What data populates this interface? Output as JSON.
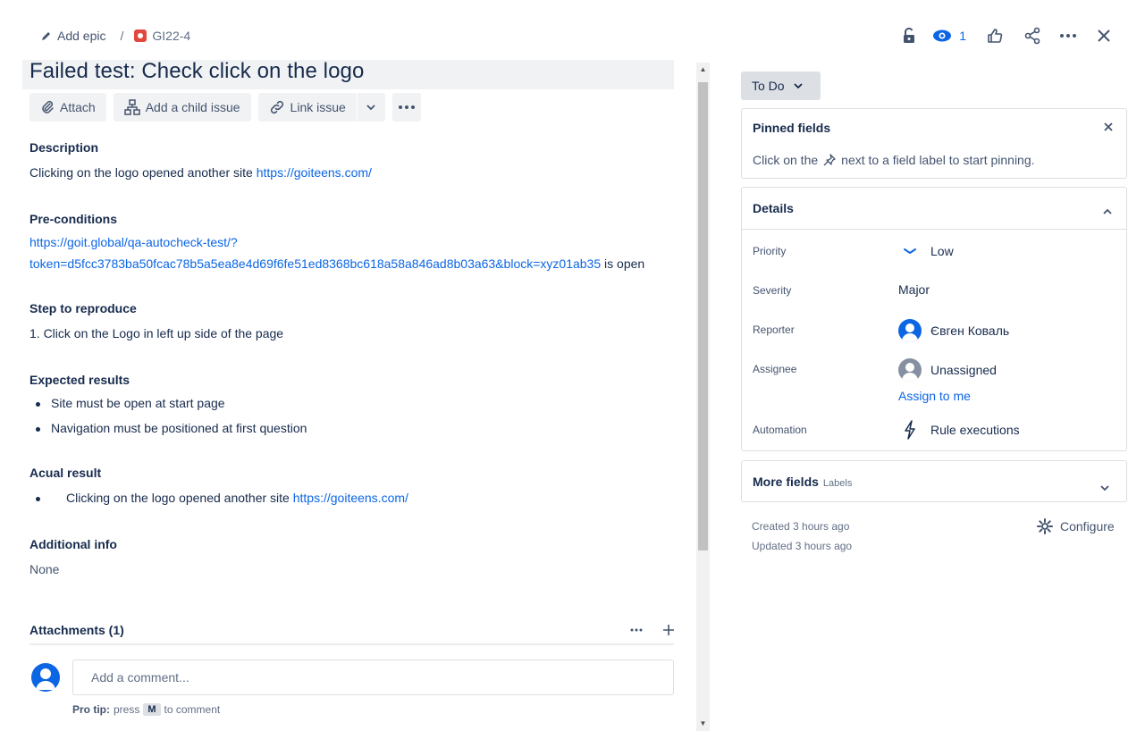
{
  "breadcrumb": {
    "add_epic": "Add epic",
    "separator": "/",
    "issue_key": "GI22-4"
  },
  "header_actions": {
    "watch_count": "1"
  },
  "issue": {
    "title": "Failed test: Check click on the logo"
  },
  "toolbar": {
    "attach": "Attach",
    "add_child": "Add a child issue",
    "link_issue": "Link issue"
  },
  "description": {
    "heading": "Description",
    "text": "Clicking on the logo opened another site ",
    "link": "https://goiteens.com/"
  },
  "preconditions": {
    "heading": "Pre-conditions",
    "link_line1": "https://goit.global/qa-autocheck-test/?",
    "link_line2": "token=d5fcc3783ba50fcac78b5a5ea8e4d69f6fe51ed8368bc618a58a846ad8b03a63&block=xyz01ab35",
    "suffix": " is open"
  },
  "steps": {
    "heading": "Step to reproduce",
    "text": "1. Click on the Logo in left up side of the page"
  },
  "expected": {
    "heading": "Expected results",
    "items": [
      "Site must be open at start page",
      "Navigation must be positioned at first question"
    ]
  },
  "actual": {
    "heading": "Acual result",
    "text": "Clicking on the logo opened another site ",
    "link": "https://goiteens.com/"
  },
  "additional": {
    "heading": "Additional info",
    "text": "None"
  },
  "attachments": {
    "heading": "Attachments (1)"
  },
  "comment": {
    "placeholder": "Add a comment...",
    "protip_label": "Pro tip:",
    "protip_press": "press",
    "protip_key": "M",
    "protip_suffix": "to comment"
  },
  "status": {
    "label": "To Do"
  },
  "pinned": {
    "heading": "Pinned fields",
    "text_before": "Click on the",
    "text_after": "next to a field label to start pinning."
  },
  "details": {
    "heading": "Details",
    "priority_label": "Priority",
    "priority_value": "Low",
    "severity_label": "Severity",
    "severity_value": "Major",
    "reporter_label": "Reporter",
    "reporter_value": "Євген Коваль",
    "assignee_label": "Assignee",
    "assignee_value": "Unassigned",
    "assign_to_me": "Assign to me",
    "automation_label": "Automation",
    "automation_value": "Rule executions"
  },
  "more_fields": {
    "heading": "More fields",
    "sub": "Labels"
  },
  "meta": {
    "created": "Created 3 hours ago",
    "updated": "Updated 3 hours ago",
    "configure": "Configure"
  },
  "colors": {
    "link": "#0c66e4",
    "bug": "#e2483d",
    "priority_low": "#0c66e4"
  }
}
